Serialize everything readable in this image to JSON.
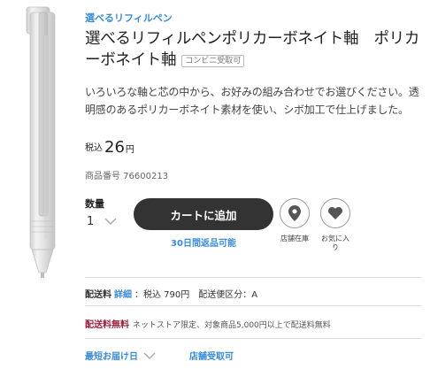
{
  "category": {
    "label": "選べるリフィルペン"
  },
  "product": {
    "title": "選べるリフィルペンポリカーボネイト軸　ポリカーボネイト軸",
    "badge": "コンビニ受取可",
    "description": "いろいろな軸と芯の中から、お好みの組み合わせでお選びください。透明感のあるポリカーボネイト素材を使い、シボ加工で仕上げました。",
    "tax_label": "税込",
    "price": "26",
    "price_unit": "円",
    "code": "商品番号 76600213"
  },
  "quantity": {
    "label": "数量",
    "value": "1"
  },
  "actions": {
    "cart_label": "カートに追加",
    "return_note": "30日間返品可能",
    "store_stock_label": "店舗在庫",
    "favorite_label": "お気に入り"
  },
  "shipping": {
    "title": "配送料",
    "detail_link": "詳細",
    "detail_text": "：税込 790円　配送便区分：A"
  },
  "free_shipping": {
    "title": "配送料無料",
    "note": "ネットストア限定、対象商品5,000円以上で配送料無料"
  },
  "delivery": {
    "earliest_label": "最短お届け日",
    "store_pickup_label": "店舗受取可"
  },
  "icons": {
    "store": "map-pin-icon",
    "favorite": "heart-icon",
    "chevron": "chevron-down-icon"
  },
  "colors": {
    "accent": "#3a8bd8",
    "cart_button": "#333333",
    "free_shipping": "#9a1f3c"
  }
}
